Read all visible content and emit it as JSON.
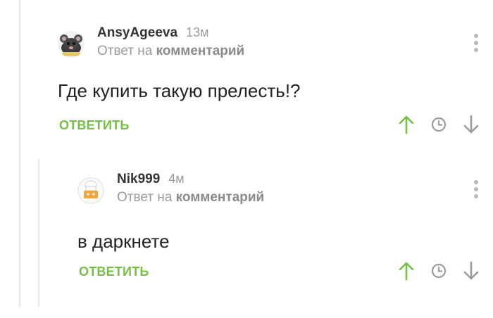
{
  "comments": [
    {
      "author": "AnsyAgeeva",
      "time": "13м",
      "reply_prefix": "Ответ на",
      "reply_link": "комментарий",
      "text": "Где купить такую прелесть!?",
      "reply_label": "ОТВЕТИТЬ",
      "avatar_icon": "rat-avatar-icon"
    },
    {
      "author": "Nik999",
      "time": "4м",
      "reply_prefix": "Ответ на",
      "reply_link": "комментарий",
      "text": "в даркнете",
      "reply_label": "ОТВЕТИТЬ",
      "avatar_icon": "chef-avatar-icon"
    }
  ],
  "colors": {
    "accent_green": "#75c044",
    "muted_gray": "#9b9b9b",
    "icon_gray": "#b9b9b9"
  }
}
